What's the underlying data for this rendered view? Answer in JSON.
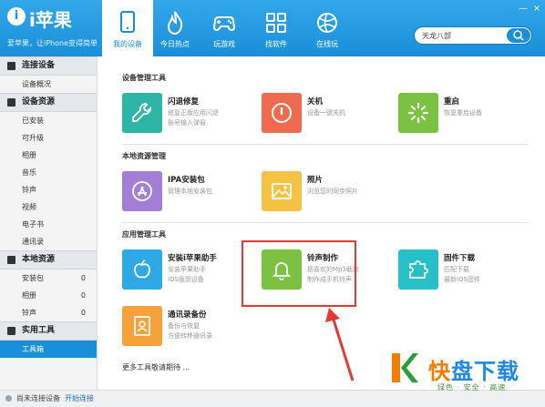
{
  "app": {
    "logo_mark": "i",
    "name": "i苹果",
    "slogan": "爱苹果，让iPhone变得简单"
  },
  "nav": {
    "tabs": [
      {
        "label": "我的设备",
        "icon": "device-icon",
        "active": true
      },
      {
        "label": "今日热点",
        "icon": "flame-icon",
        "active": false
      },
      {
        "label": "玩游戏",
        "icon": "gamepad-icon",
        "active": false
      },
      {
        "label": "找软件",
        "icon": "apps-grid-icon",
        "active": false
      },
      {
        "label": "在线玩",
        "icon": "globe-icon",
        "active": false
      }
    ]
  },
  "window_controls": {
    "minimize": "—",
    "close": "×"
  },
  "search": {
    "value": "天龙八部",
    "placeholder": "天龙八部"
  },
  "sidebar": {
    "sections": [
      {
        "title": "连接设备",
        "icon": "phone-icon",
        "items": [
          {
            "label": "设备概况",
            "count": ""
          }
        ]
      },
      {
        "title": "设备资源",
        "icon": "phone-icon",
        "items": [
          {
            "label": "已安装",
            "count": ""
          },
          {
            "label": "可升级",
            "count": ""
          },
          {
            "label": "相册",
            "count": ""
          },
          {
            "label": "音乐",
            "count": ""
          },
          {
            "label": "铃声",
            "count": ""
          },
          {
            "label": "视频",
            "count": ""
          },
          {
            "label": "电子书",
            "count": ""
          },
          {
            "label": "通讯录",
            "count": ""
          }
        ]
      },
      {
        "title": "本地资源",
        "icon": "monitor-icon",
        "items": [
          {
            "label": "安装包",
            "count": "0"
          },
          {
            "label": "相册",
            "count": "0"
          },
          {
            "label": "铃声",
            "count": "0"
          }
        ]
      },
      {
        "title": "实用工具",
        "icon": "toolbox-icon",
        "items": [
          {
            "label": "工具箱",
            "count": "",
            "active": true
          }
        ]
      }
    ]
  },
  "main": {
    "groups": [
      {
        "title": "设备管理工具",
        "tiles": [
          {
            "name": "闪退修复",
            "desc": [
              "修复正版应用闪退",
              "账号输入弹窗"
            ],
            "color": "#2fb5a8",
            "icon": "wrench-icon"
          },
          {
            "name": "关机",
            "desc": [
              "设备一键关机"
            ],
            "color": "#f06a50",
            "icon": "power-icon"
          },
          {
            "name": "重启",
            "desc": [
              "恢复重启设备"
            ],
            "color": "#7cc242",
            "icon": "spinner-icon"
          }
        ]
      },
      {
        "title": "本地资源管理",
        "tiles": [
          {
            "name": "IPA安装包",
            "desc": [
              "管理本地安装包"
            ],
            "color": "#a27ed6",
            "icon": "app-store-icon"
          },
          {
            "name": "照片",
            "desc": [
              "浏览您的同步照片"
            ],
            "color": "#f5c244",
            "icon": "photo-icon"
          }
        ]
      },
      {
        "title": "应用管理工具",
        "tiles": [
          {
            "name": "安装i苹果助手",
            "desc": [
              "安装苹果助手",
              "iOS版到设备"
            ],
            "color": "#2fa8e8",
            "icon": "apple-logo-icon"
          },
          {
            "name": "铃声制作",
            "desc": [
              "把喜欢的Mp3截取",
              "制作成手机铃声"
            ],
            "color": "#7cc242",
            "icon": "bell-icon"
          },
          {
            "name": "固件下载",
            "desc": [
              "匹配下载",
              "最新iOS固件"
            ],
            "color": "#27c0c8",
            "icon": "puzzle-icon"
          },
          {
            "name": "通讯录备份",
            "desc": [
              "备份与恢复",
              "方便转移通讯录"
            ],
            "color": "#f5a23a",
            "icon": "contacts-icon"
          }
        ]
      }
    ],
    "more_link": "更多工具敬请期待 ..."
  },
  "statusbar": {
    "text": "尚未连接设备",
    "link": "开始连接"
  },
  "watermark": {
    "name_part1": "快",
    "name_part2": "盘下载",
    "tagline": "绿色 · 安全 · 高速"
  }
}
